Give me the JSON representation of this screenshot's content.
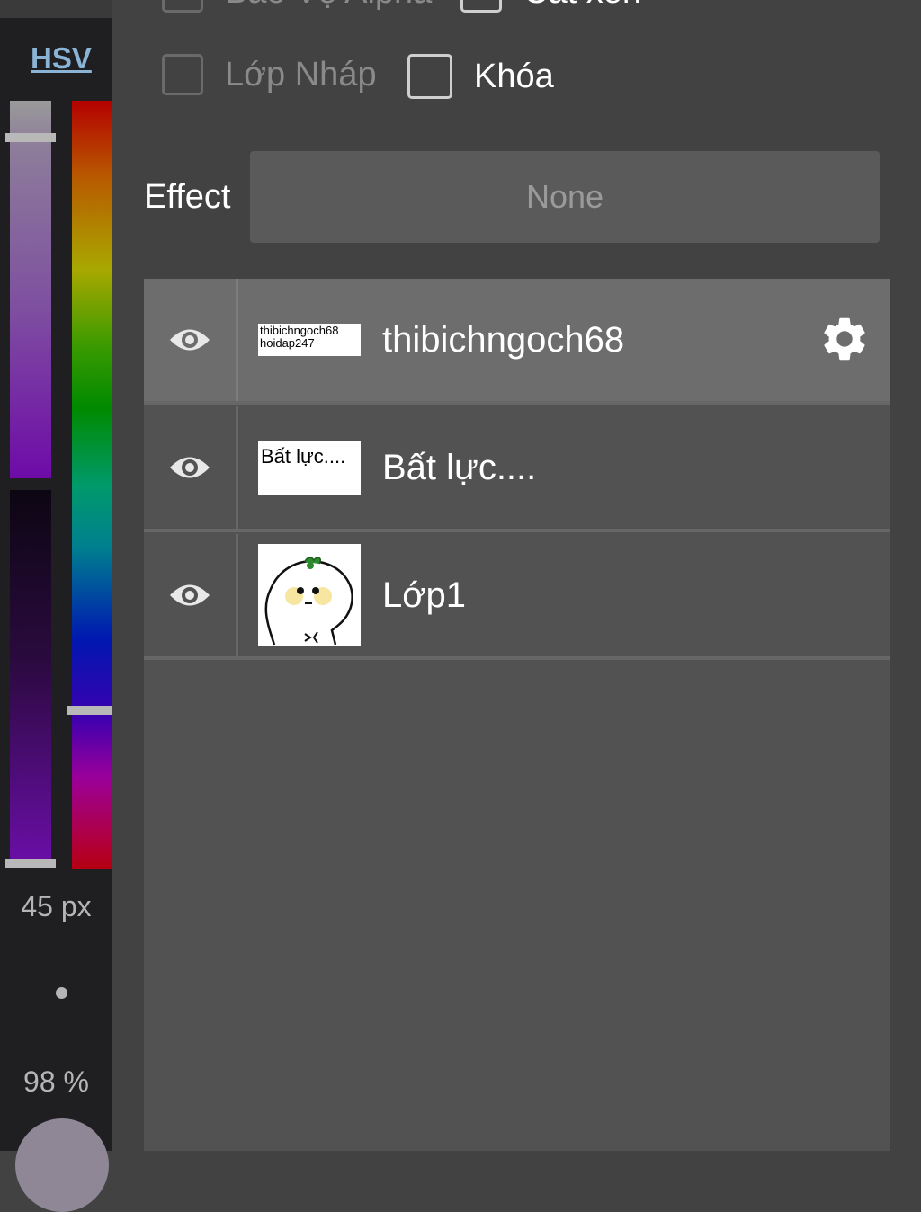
{
  "sidebar": {
    "mode_label": "HSV",
    "brush_size": "45 px",
    "opacity": "98 %",
    "colors": {
      "current": "#8f8696"
    }
  },
  "options": {
    "alpha_protect": "Bảo Vệ Alpha",
    "clipping": "Cắt xén",
    "draft_layer": "Lớp Nháp",
    "lock": "Khóa"
  },
  "effect": {
    "label": "Effect",
    "value": "None"
  },
  "layers": [
    {
      "name": "thibichngoch68",
      "thumb_line1": "thibichngoch68",
      "thumb_line2": "hoidap247",
      "selected": true
    },
    {
      "name": "Bất lực....",
      "thumb_text": "Bất lực....",
      "selected": false
    },
    {
      "name": "Lớp1",
      "thumb": "cartoon-character",
      "selected": false
    }
  ]
}
